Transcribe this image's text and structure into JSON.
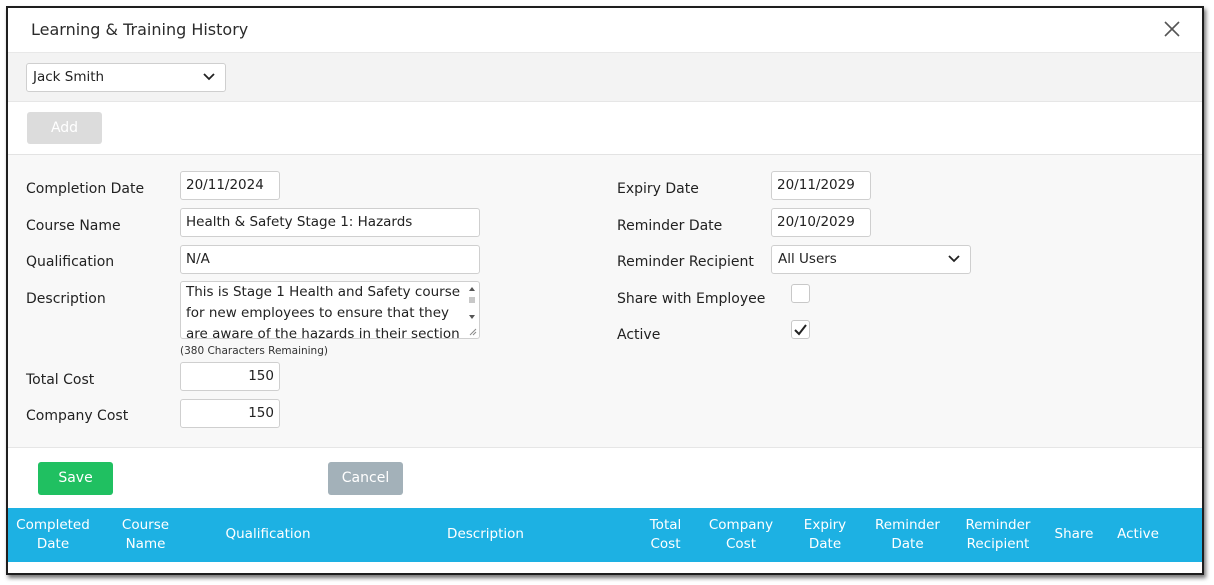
{
  "dialog": {
    "title": "Learning & Training History",
    "close_icon": "close-icon"
  },
  "employee_select": {
    "value": "Jack Smith"
  },
  "toolbar": {
    "add_label": "Add"
  },
  "form": {
    "completion_date": {
      "label": "Completion Date",
      "value": "20/11/2024"
    },
    "course_name": {
      "label": "Course Name",
      "value": "Health & Safety Stage 1: Hazards"
    },
    "qualification": {
      "label": "Qualification",
      "value": "N/A"
    },
    "description": {
      "label": "Description",
      "value": "This is Stage 1 Health and Safety course for new employees to ensure that they are aware of the hazards in their section",
      "remaining": "(380 Characters Remaining)"
    },
    "total_cost": {
      "label": "Total Cost",
      "value": "150"
    },
    "company_cost": {
      "label": "Company Cost",
      "value": "150"
    },
    "expiry_date": {
      "label": "Expiry Date",
      "value": "20/11/2029"
    },
    "reminder_date": {
      "label": "Reminder Date",
      "value": "20/10/2029"
    },
    "reminder_recipient": {
      "label": "Reminder Recipient",
      "value": "All Users"
    },
    "share_with_employee": {
      "label": "Share with Employee",
      "checked": false
    },
    "active": {
      "label": "Active",
      "checked": true
    }
  },
  "actions": {
    "save_label": "Save",
    "cancel_label": "Cancel"
  },
  "table": {
    "headers": {
      "completed_date_1": "Completed",
      "completed_date_2": "Date",
      "course_name_1": "Course",
      "course_name_2": "Name",
      "qualification": "Qualification",
      "description": "Description",
      "total_cost_1": "Total",
      "total_cost_2": "Cost",
      "company_cost_1": "Company",
      "company_cost_2": "Cost",
      "expiry_date_1": "Expiry",
      "expiry_date_2": "Date",
      "reminder_date_1": "Reminder",
      "reminder_date_2": "Date",
      "reminder_recipient_1": "Reminder",
      "reminder_recipient_2": "Recipient",
      "share": "Share",
      "active": "Active"
    }
  },
  "colors": {
    "header_bg": "#1db1e3",
    "save_bg": "#20c061",
    "cancel_bg": "#a3b1b9",
    "add_bg": "#dcdcdc"
  }
}
